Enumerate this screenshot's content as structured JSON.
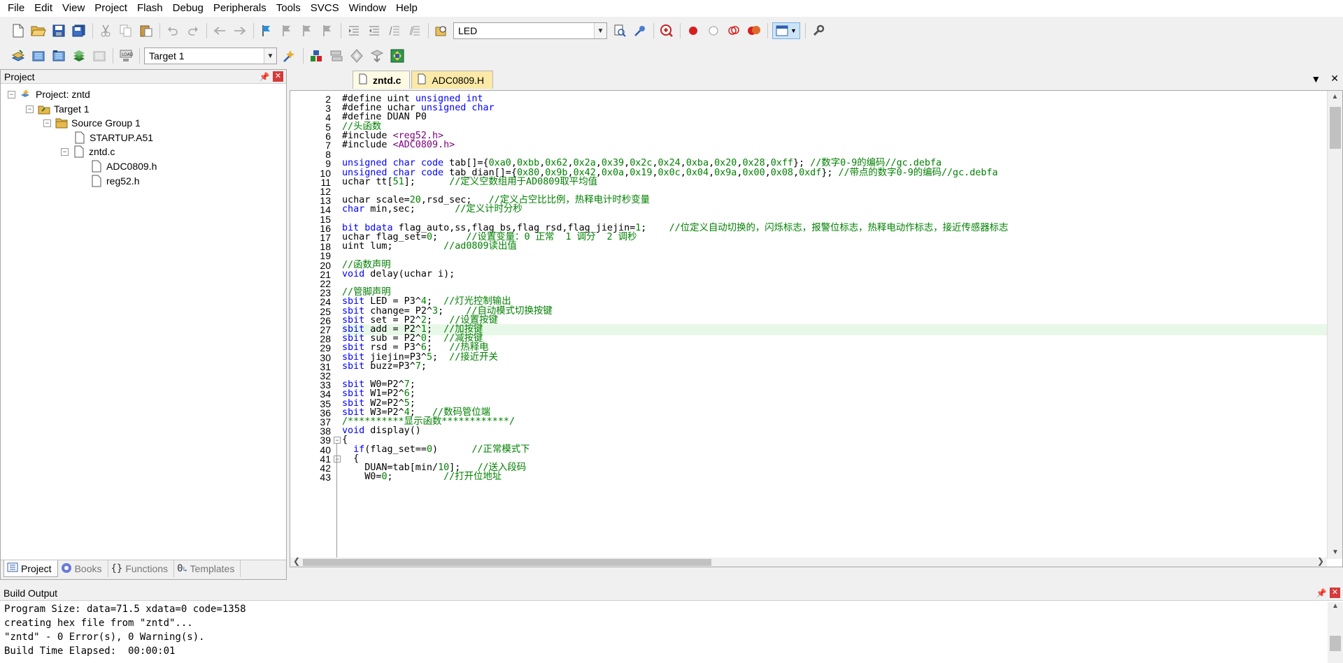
{
  "menu": [
    "File",
    "Edit",
    "View",
    "Project",
    "Flash",
    "Debug",
    "Peripherals",
    "Tools",
    "SVCS",
    "Window",
    "Help"
  ],
  "toolbar": {
    "find_combo_value": "LED",
    "target_combo_value": "Target 1"
  },
  "project_panel": {
    "title": "Project",
    "tree": [
      {
        "label": "Project: zntd",
        "level": 0,
        "icon": "project-icon",
        "expander": "−"
      },
      {
        "label": "Target 1",
        "level": 1,
        "icon": "target-icon",
        "expander": "−"
      },
      {
        "label": "Source Group 1",
        "level": 2,
        "icon": "folder-icon",
        "expander": "−"
      },
      {
        "label": "STARTUP.A51",
        "level": 3,
        "icon": "file-icon",
        "expander": ""
      },
      {
        "label": "zntd.c",
        "level": 3,
        "icon": "file-icon",
        "expander": "−"
      },
      {
        "label": "ADC0809.h",
        "level": 4,
        "icon": "file-icon",
        "expander": ""
      },
      {
        "label": "reg52.h",
        "level": 4,
        "icon": "file-icon",
        "expander": ""
      }
    ],
    "tabs": [
      "Project",
      "Books",
      "Functions",
      "Templates"
    ]
  },
  "editor": {
    "tabs": [
      {
        "label": "zntd.c",
        "active": true
      },
      {
        "label": "ADC0809.H",
        "active": false
      }
    ],
    "current_line": 27,
    "lines": [
      {
        "n": 2,
        "t": "#define uint unsigned int"
      },
      {
        "n": 3,
        "t": "#define uchar unsigned char"
      },
      {
        "n": 4,
        "t": "#define DUAN P0"
      },
      {
        "n": 5,
        "t": "//头函数"
      },
      {
        "n": 6,
        "t": "#include <reg52.h>"
      },
      {
        "n": 7,
        "t": "#include <ADC0809.h>"
      },
      {
        "n": 8,
        "t": ""
      },
      {
        "n": 9,
        "t": "unsigned char code tab[]={0xa0,0xbb,0x62,0x2a,0x39,0x2c,0x24,0xba,0x20,0x28,0xff}; //数字0-9的编码//gc.debfa"
      },
      {
        "n": 10,
        "t": "unsigned char code tab_dian[]={0x80,0x9b,0x42,0x0a,0x19,0x0c,0x04,0x9a,0x00,0x08,0xdf}; //带点的数字0-9的编码//gc.debfa"
      },
      {
        "n": 11,
        "t": "uchar tt[51];      //定义空数组用于AD0809取平均值"
      },
      {
        "n": 12,
        "t": ""
      },
      {
        "n": 13,
        "t": "uchar scale=20,rsd_sec;   //定义占空比比例，热释电计时秒变量"
      },
      {
        "n": 14,
        "t": "char min,sec;       //定义计时分秒"
      },
      {
        "n": 15,
        "t": ""
      },
      {
        "n": 16,
        "t": "bit bdata flag_auto,ss,flag_bs,flag_rsd,flag_jiejin=1;    //位定义自动切换的，闪烁标志，报警位标志，热释电动作标志，接近传感器标志"
      },
      {
        "n": 17,
        "t": "uchar flag_set=0;     //设置变量：0 正常  1 调分  2 调秒"
      },
      {
        "n": 18,
        "t": "uint lum;         //ad0809读出值"
      },
      {
        "n": 19,
        "t": ""
      },
      {
        "n": 20,
        "t": "//函数声明"
      },
      {
        "n": 21,
        "t": "void delay(uchar i);"
      },
      {
        "n": 22,
        "t": ""
      },
      {
        "n": 23,
        "t": "//管脚声明"
      },
      {
        "n": 24,
        "t": "sbit LED = P3^4;  //灯光控制输出"
      },
      {
        "n": 25,
        "t": "sbit change= P2^3;    //自动模式切换按键"
      },
      {
        "n": 26,
        "t": "sbit set = P2^2;   //设置按键"
      },
      {
        "n": 27,
        "t": "sbit add = P2^1;  //加按键"
      },
      {
        "n": 28,
        "t": "sbit sub = P2^0;  //减按键"
      },
      {
        "n": 29,
        "t": "sbit rsd = P3^6;   //热释电"
      },
      {
        "n": 30,
        "t": "sbit jiejin=P3^5;  //接近开关"
      },
      {
        "n": 31,
        "t": "sbit buzz=P3^7;"
      },
      {
        "n": 32,
        "t": ""
      },
      {
        "n": 33,
        "t": "sbit W0=P2^7;"
      },
      {
        "n": 34,
        "t": "sbit W1=P2^6;"
      },
      {
        "n": 35,
        "t": "sbit W2=P2^5;"
      },
      {
        "n": 36,
        "t": "sbit W3=P2^4;   //数码管位端"
      },
      {
        "n": 37,
        "t": "/**********显示函数************/"
      },
      {
        "n": 38,
        "t": "void display()"
      },
      {
        "n": 39,
        "t": "{"
      },
      {
        "n": 40,
        "t": "  if(flag_set==0)      //正常模式下"
      },
      {
        "n": 41,
        "t": "  {"
      },
      {
        "n": 42,
        "t": "    DUAN=tab[min/10];   //送入段码"
      },
      {
        "n": 43,
        "t": "    W0=0;         //打开位地址"
      }
    ]
  },
  "build_output": {
    "title": "Build Output",
    "lines": [
      "Program Size: data=71.5 xdata=0 code=1358",
      "creating hex file from \"zntd\"...",
      "\"zntd\" - 0 Error(s), 0 Warning(s).",
      "Build Time Elapsed:  00:00:01"
    ]
  },
  "colors": {
    "keyword": "#0000ff",
    "comment": "#008000",
    "number": "#008000",
    "include_path": "#800080",
    "current_line_bg": "#e8f8e8"
  }
}
